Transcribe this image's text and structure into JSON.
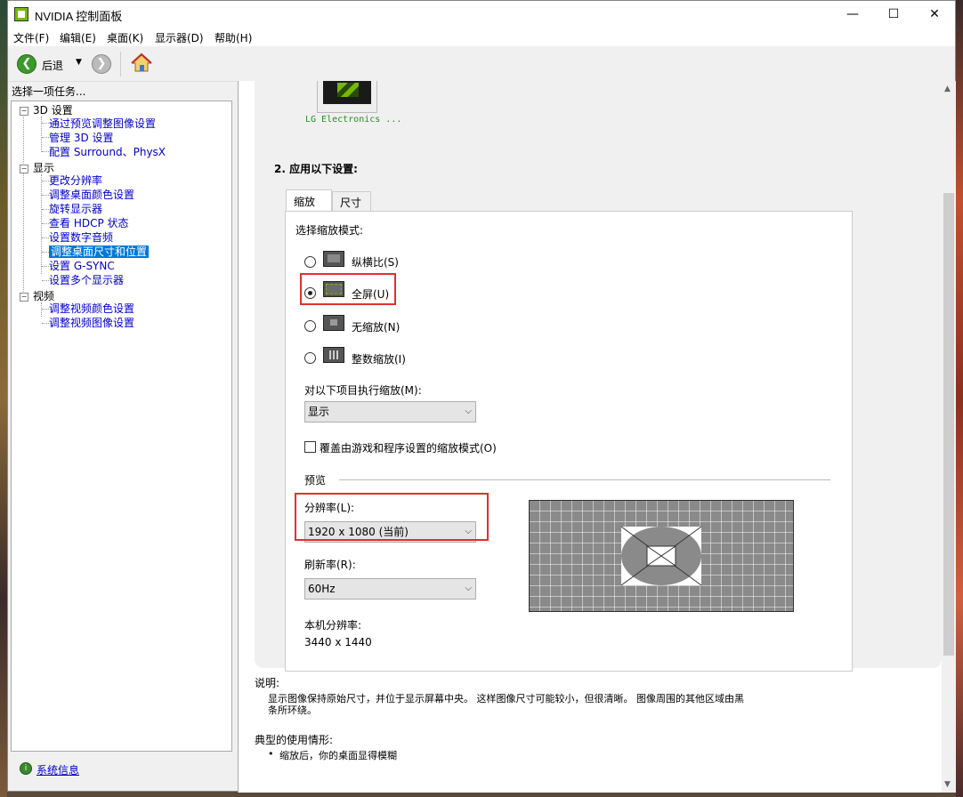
{
  "window": {
    "title": "NVIDIA 控制面板",
    "minimize": "—",
    "maximize": "☐",
    "close": "✕"
  },
  "menu": [
    "文件(F)",
    "编辑(E)",
    "桌面(K)",
    "显示器(D)",
    "帮助(H)"
  ],
  "toolbar": {
    "back_label": "后退"
  },
  "sidebar": {
    "header": "选择一项任务...",
    "categories": [
      {
        "label": "3D 设置",
        "items": [
          "通过预览调整图像设置",
          "管理 3D 设置",
          "配置 Surround、PhysX"
        ]
      },
      {
        "label": "显示",
        "items": [
          "更改分辨率",
          "调整桌面颜色设置",
          "旋转显示器",
          "查看 HDCP 状态",
          "设置数字音频",
          "调整桌面尺寸和位置",
          "设置 G-SYNC",
          "设置多个显示器"
        ],
        "selected": 5
      },
      {
        "label": "视频",
        "items": [
          "调整视频颜色设置",
          "调整视频图像设置"
        ]
      }
    ],
    "system_info": "系统信息"
  },
  "main": {
    "monitor_label": "LG Electronics ...",
    "section2_title": "2. 应用以下设置:",
    "tabs": [
      "缩放",
      "尺寸"
    ],
    "scaling_mode_label": "选择缩放模式:",
    "modes": [
      "纵横比(S)",
      "全屏(U)",
      "无缩放(N)",
      "整数缩放(I)"
    ],
    "selected_mode": 1,
    "perform_on_label": "对以下项目执行缩放(M):",
    "perform_on_value": "显示",
    "override_label": "覆盖由游戏和程序设置的缩放模式(O)",
    "override_checked": false,
    "preview_label": "预览",
    "resolution_label": "分辨率(L):",
    "resolution_value": "1920 x 1080 (当前)",
    "refresh_label": "刷新率(R):",
    "refresh_value": "60Hz",
    "native_label": "本机分辨率:",
    "native_value": "3440 x 1440"
  },
  "description": {
    "label": "说明:",
    "text1": "显示图像保持原始尺寸，并位于显示屏幕中央。 这样图像尺寸可能较小，但很清晰。 图像周围的其他区域由黑",
    "text2": "条所环绕。"
  },
  "typical": {
    "label": "典型的使用情形:",
    "bullet": "•",
    "item": "缩放后，你的桌面显得模糊"
  },
  "colors": {
    "nvidia_green": "#76b900",
    "selection_blue": "#0078d7",
    "highlight_red": "#e03030",
    "link_blue": "#0000cc"
  }
}
